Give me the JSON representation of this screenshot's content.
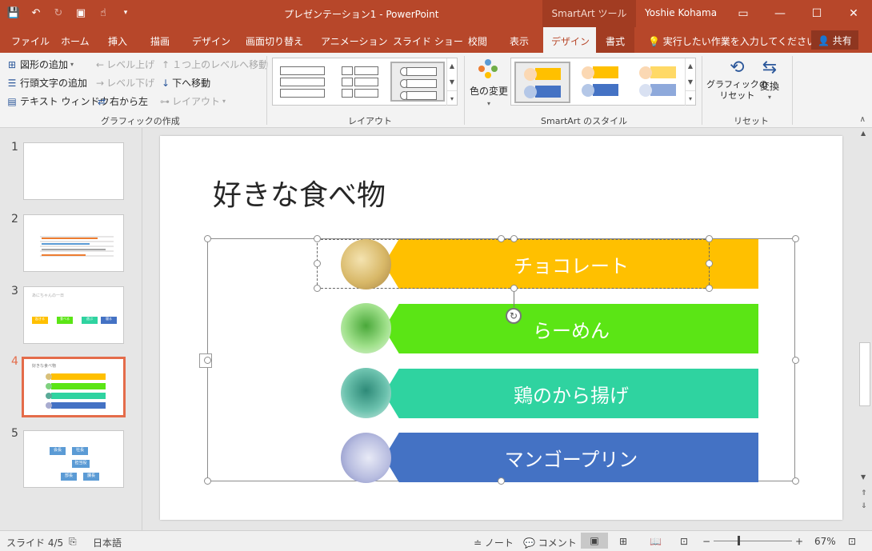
{
  "window": {
    "title": "プレゼンテーション1 - PowerPoint",
    "context_label": "SmartArt ツール",
    "user": "Yoshie Kohama"
  },
  "tabs": [
    "ファイル",
    "ホーム",
    "挿入",
    "描画",
    "デザイン",
    "画面切り替え",
    "アニメーション",
    "スライド ショー",
    "校閲",
    "表示",
    "デザイン",
    "書式"
  ],
  "search_placeholder": "実行したい作業を入力してください",
  "share_label": "共有",
  "ribbon": {
    "create": {
      "add_shape": "図形の追加",
      "add_bullet": "行頭文字の追加",
      "text_pane": "テキスト ウィンドウ",
      "promote": "レベル上げ",
      "demote": "レベル下げ",
      "move_up": "１つ上のレベルへ移動",
      "move_down": "下へ移動",
      "rtl": "右から左",
      "layout": "レイアウト",
      "group": "グラフィックの作成"
    },
    "layouts_group": "レイアウト",
    "styles": {
      "change_colors": "色の変更",
      "group": "SmartArt のスタイル"
    },
    "reset": {
      "reset_graphic": "グラフィックの\nリセット",
      "convert": "変換",
      "group": "リセット"
    }
  },
  "slides": [
    {
      "num": "1"
    },
    {
      "num": "2"
    },
    {
      "num": "3",
      "title": "あにちゃんの一日",
      "items": [
        "起きる",
        "食べる",
        "遊ぶ",
        "寝る"
      ]
    },
    {
      "num": "4",
      "title": "好きな食べ物"
    },
    {
      "num": "5",
      "items": [
        "会長",
        "社長",
        "担当役",
        "部長",
        "課長"
      ]
    }
  ],
  "current_slide": {
    "title": "好きな食べ物",
    "items": [
      {
        "label": "チョコレート",
        "color": "#ffc000"
      },
      {
        "label": "らーめん",
        "color": "#5be515"
      },
      {
        "label": "鶏のから揚げ",
        "color": "#2fd3a0"
      },
      {
        "label": "マンゴープリン",
        "color": "#4472c4"
      }
    ]
  },
  "status": {
    "slide_indicator": "スライド 4/5",
    "language": "日本語",
    "notes": "ノート",
    "comments": "コメント",
    "zoom": "67%"
  }
}
